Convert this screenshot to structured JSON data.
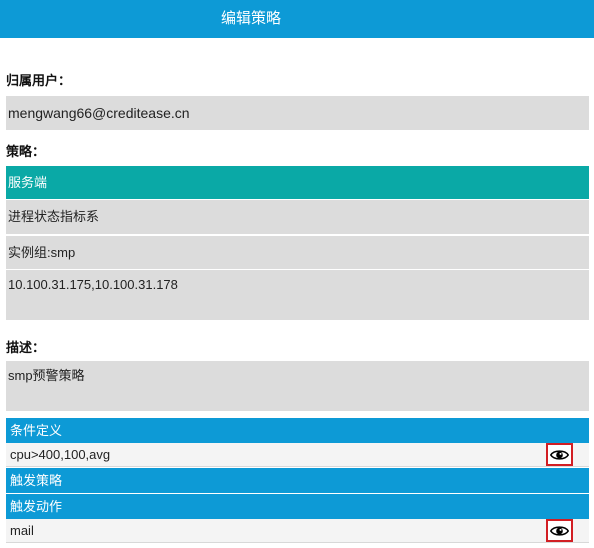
{
  "header": {
    "title": "编辑策略"
  },
  "owner": {
    "label": "归属用户：",
    "value": "mengwang66@creditease.cn"
  },
  "policy": {
    "label": "策略：",
    "category": "服务端",
    "metric": "进程状态指标系",
    "instance_group": "实例组:smp",
    "hosts": "10.100.31.175,10.100.31.178"
  },
  "description": {
    "label": "描述：",
    "value": "smp预警策略"
  },
  "conditions": {
    "header": "条件定义",
    "items": [
      "cpu>400,100,avg"
    ]
  },
  "trigger_policy": {
    "header": "触发策略"
  },
  "trigger_action": {
    "header": "触发动作",
    "items": [
      "mail"
    ]
  },
  "icons": {
    "view": "eye-icon"
  },
  "colors": {
    "header_bg": "#0d9ad6",
    "category_bg": "#0aa9a6",
    "field_bg": "#dcdcdc",
    "highlight_border": "#d21e23"
  }
}
